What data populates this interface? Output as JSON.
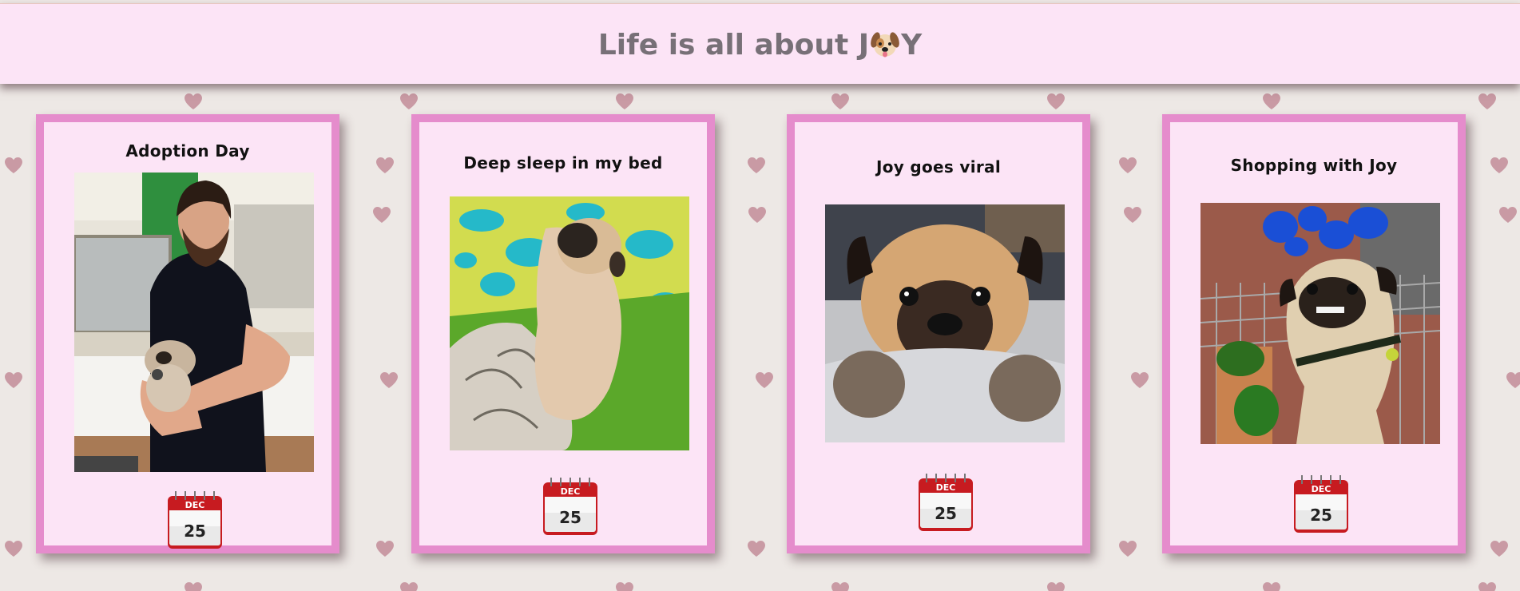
{
  "header": {
    "title_prefix": "Life is all about J",
    "title_suffix": "Y",
    "title_icon": "dog-face-icon"
  },
  "cards": [
    {
      "title": "Adoption Day",
      "photo": "photo-man-holding-pug-puppy",
      "calendar": {
        "month": "DEC",
        "day": "25"
      }
    },
    {
      "title": "Deep sleep in my bed",
      "photo": "photo-pug-sleeping-on-bed",
      "calendar": {
        "month": "DEC",
        "day": "25"
      }
    },
    {
      "title": "Joy goes viral",
      "photo": "photo-pug-closeup-on-bed",
      "calendar": {
        "month": "DEC",
        "day": "25"
      }
    },
    {
      "title": "Shopping with Joy",
      "photo": "photo-pug-in-shopping-cart",
      "calendar": {
        "month": "DEC",
        "day": "25"
      }
    }
  ],
  "colors": {
    "background": "#ede8e5",
    "header_background": "#fce4f6",
    "card_background": "#fce4f6",
    "card_border": "#e58ccc",
    "title_text": "#777077",
    "heart": "#c99aa4",
    "calendar_red": "#dd1c22"
  }
}
